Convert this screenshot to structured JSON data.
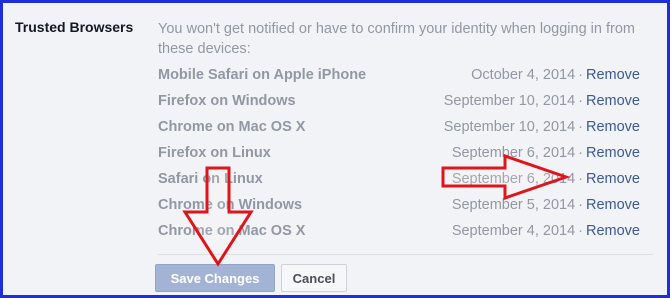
{
  "section": {
    "title": "Trusted Browsers",
    "description": "You won't get notified or have to confirm your identity when logging in from these devices:"
  },
  "devices": [
    {
      "name": "Mobile Safari on Apple iPhone",
      "date": "October 4, 2014",
      "separator": "·",
      "action": "Remove"
    },
    {
      "name": "Firefox on Windows",
      "date": "September 10, 2014",
      "separator": "·",
      "action": "Remove"
    },
    {
      "name": "Chrome on Mac OS X",
      "date": "September 10, 2014",
      "separator": "·",
      "action": "Remove"
    },
    {
      "name": "Firefox on Linux",
      "date": "September 6, 2014",
      "separator": "·",
      "action": "Remove"
    },
    {
      "name": "Safari on Linux",
      "date": "September 6, 2014",
      "separator": "·",
      "action": "Remove"
    },
    {
      "name": "Chrome on Windows",
      "date": "September 5, 2014",
      "separator": "·",
      "action": "Remove"
    },
    {
      "name": "Chrome on Mac OS X",
      "date": "September 4, 2014",
      "separator": "·",
      "action": "Remove"
    }
  ],
  "buttons": {
    "save": "Save Changes",
    "cancel": "Cancel"
  },
  "annotations": {
    "arrow_color": "#e0141b",
    "arrows": [
      "down-arrow",
      "right-arrow"
    ]
  },
  "colors": {
    "frame_border": "#1e2fd8",
    "link": "#3b5998"
  }
}
